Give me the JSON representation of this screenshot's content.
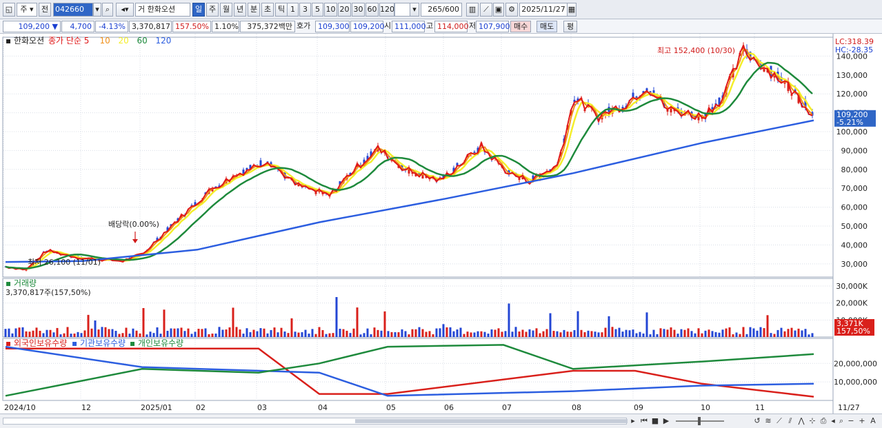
{
  "toolbar": {
    "type_select": "주",
    "prev_label": "전",
    "code": "042660",
    "stock_prefix": "거",
    "stock_name": "한화오션",
    "periods": [
      "일",
      "주",
      "월",
      "년",
      "분",
      "초",
      "틱"
    ],
    "active_period": "일",
    "counts": [
      "1",
      "3",
      "5",
      "10",
      "20",
      "30",
      "60",
      "120"
    ],
    "view_count": "265",
    "view_total": "/600",
    "date": "2025/11/27"
  },
  "quote": {
    "price": "109,200",
    "arrow": "▼",
    "change": "4,700",
    "change_pct": "-4.13%",
    "volume": "3,370,817",
    "vol_ratio": "157.50%",
    "turnover": "1.10%",
    "amount": "375,372백만",
    "ask_label": "호가",
    "ask": "109,300",
    "bid": "109,200",
    "open_label": "시",
    "open": "111,000",
    "high_label": "고",
    "high": "114,000",
    "low_label": "저",
    "low": "107,900",
    "buy_label": "매수",
    "sell_label": "매도",
    "eval_label": "평"
  },
  "colors": {
    "up": "#d9201b",
    "down": "#2346d4",
    "ma5": "#e01818",
    "ma10": "#f0901a",
    "ma20": "#f4ee2a",
    "ma60": "#1e8a3c",
    "ma120": "#2c5ee0"
  },
  "chart_data": [
    {
      "type": "line",
      "title": "한화오션",
      "legend": [
        "종가 단순 5",
        "10",
        "20",
        "60",
        "120"
      ],
      "x_ticks": [
        "2024/10",
        "12",
        "2025/01",
        "02",
        "03",
        "04",
        "05",
        "06",
        "07",
        "08",
        "09",
        "10",
        "11",
        "11/27"
      ],
      "y_ticks": [
        "30,000",
        "40,000",
        "50,000",
        "60,000",
        "70,000",
        "80,000",
        "90,000",
        "100,000",
        "110,000",
        "120,000",
        "130,000",
        "140,000"
      ],
      "ylim": [
        23000,
        150000
      ],
      "current": "109,200",
      "current_pct": "-5.21%",
      "lc_label": "LC:318.39",
      "hc_label": "HC:-28.35",
      "max_label": "최고 152,400 (10/30)",
      "min_label": "최저 26,100 (11/01)",
      "dividend_label": "배당락(0.00%)",
      "series": [
        {
          "name": "종가",
          "x": [
            "2024/10",
            "2024/11",
            "2024/12",
            "2025/01",
            "2025/02",
            "2025/03",
            "2025/04",
            "2025/05",
            "2025/06",
            "2025/07",
            "2025/08",
            "2025/09",
            "2025/10",
            "2025/11",
            "2025/11/27"
          ],
          "values": [
            28500,
            34000,
            33500,
            35500,
            62000,
            78000,
            70000,
            79000,
            75000,
            76000,
            115000,
            118000,
            112000,
            135000,
            109200
          ]
        },
        {
          "name": "120",
          "x": [
            "2024/10",
            "2024/12",
            "2025/02",
            "2025/04",
            "2025/06",
            "2025/08",
            "2025/10",
            "2025/11/27"
          ],
          "values": [
            31000,
            31500,
            37500,
            52000,
            64500,
            78000,
            94000,
            106000
          ]
        }
      ]
    },
    {
      "type": "bar",
      "title": "거래량",
      "value_label": "3,370,817주(157,50%)",
      "y_ticks": [
        "10,000K",
        "20,000K",
        "30,000K"
      ],
      "badge_value": "3,371K",
      "badge_pct": "157,50%",
      "ylim": [
        0,
        32000
      ]
    },
    {
      "type": "line",
      "legend": [
        "외국인보유수량",
        "기관보유수량",
        "개인보유수량"
      ],
      "y_ticks": [
        "10,000,000",
        "20,000,000"
      ],
      "series": [
        {
          "name": "외국인보유수량",
          "x": [
            "2024/10",
            "2025/03",
            "2025/04",
            "2025/05",
            "2025/08",
            "2025/09",
            "2025/10",
            "2025/11/27"
          ],
          "values": [
            28000000,
            28000000,
            3500000,
            3500000,
            16000000,
            16000000,
            9000000,
            2000000
          ]
        },
        {
          "name": "기관보유수량",
          "x": [
            "2024/10",
            "2025/01",
            "2025/04",
            "2025/05",
            "2025/08",
            "2025/10",
            "2025/11/27"
          ],
          "values": [
            29000000,
            18000000,
            15000000,
            2500000,
            5000000,
            8000000,
            9000000
          ]
        },
        {
          "name": "개인보유수량",
          "x": [
            "2024/10",
            "2025/01",
            "2025/03",
            "2025/04",
            "2025/05",
            "2025/07",
            "2025/08",
            "2025/10",
            "2025/11/27"
          ],
          "values": [
            2500000,
            17000000,
            15000000,
            20000000,
            29000000,
            30000000,
            17000000,
            21000000,
            25000000
          ]
        }
      ]
    }
  ]
}
